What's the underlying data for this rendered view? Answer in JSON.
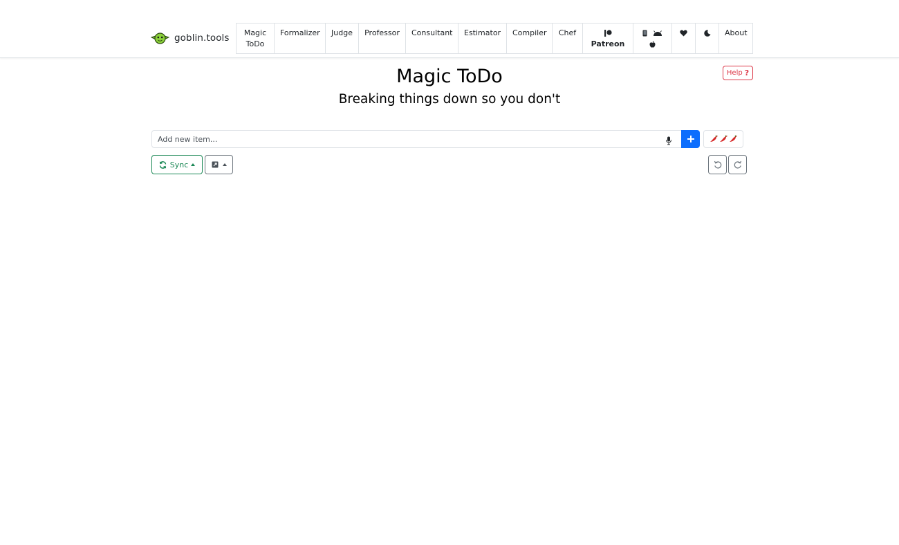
{
  "brand": {
    "name": "goblin.tools",
    "logo_icon": "goblin-face-icon"
  },
  "nav": {
    "tabs": [
      {
        "id": "magic-todo",
        "line1": "Magic",
        "line2": "ToDo"
      },
      {
        "id": "formalizer",
        "line1": "Formalizer"
      },
      {
        "id": "judge",
        "line1": "Judge"
      },
      {
        "id": "professor",
        "line1": "Professor"
      },
      {
        "id": "consultant",
        "line1": "Consultant"
      },
      {
        "id": "estimator",
        "line1": "Estimator"
      },
      {
        "id": "compiler",
        "line1": "Compiler"
      },
      {
        "id": "chef",
        "line1": "Chef"
      },
      {
        "id": "patreon",
        "icon": "patreon-icon",
        "line2": "Patreon"
      },
      {
        "id": "apps",
        "icons": [
          "phone-icon",
          "android-icon",
          "apple-icon"
        ]
      },
      {
        "id": "support",
        "icon": "heart-icon"
      },
      {
        "id": "theme",
        "icon": "moon-icon"
      },
      {
        "id": "about",
        "line1": "About"
      }
    ]
  },
  "main": {
    "title": "Magic ToDo",
    "subtitle": "Breaking things down so you don't",
    "help_label": "Help",
    "help_icon": "question-mark-icon",
    "input": {
      "placeholder": "Add new item...",
      "value": ""
    },
    "spiciness_icon": "chili-pepper-icon",
    "spiciness_level": 3,
    "sync_label": "Sync",
    "colors": {
      "primary": "#0d6efd",
      "success": "#198754",
      "danger": "#dc3545",
      "secondary": "#6c757d"
    }
  }
}
